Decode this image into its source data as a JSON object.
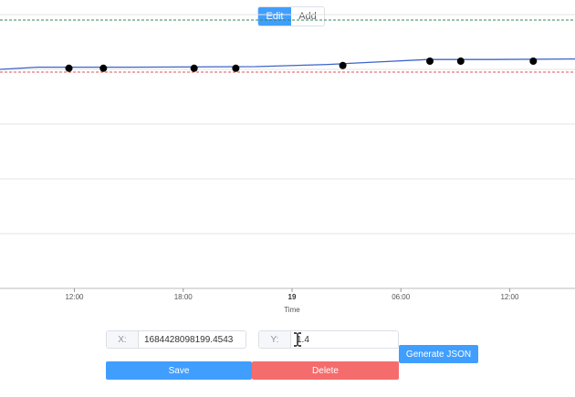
{
  "mode_toggle": {
    "edit_label": "Edit",
    "add_label": "Add",
    "active": "edit"
  },
  "chart_data": {
    "type": "line",
    "xlabel": "Time",
    "x_ticks": [
      {
        "label": "12:00",
        "x": 12
      },
      {
        "label": "18:00",
        "x": 18
      },
      {
        "label": "19",
        "x": 24,
        "bold": true
      },
      {
        "label": "06:00",
        "x": 30
      },
      {
        "label": "12:00",
        "x": 36
      }
    ],
    "xlim": [
      7.9,
      39.6
    ],
    "ylim": [
      0,
      5
    ],
    "grid": true,
    "upper_threshold": 4.9,
    "lower_threshold": 3.95,
    "line": [
      {
        "x": 7.9,
        "y": 4.0
      },
      {
        "x": 10,
        "y": 4.04
      },
      {
        "x": 15,
        "y": 4.04
      },
      {
        "x": 22,
        "y": 4.05
      },
      {
        "x": 26,
        "y": 4.09
      },
      {
        "x": 29,
        "y": 4.14
      },
      {
        "x": 31.5,
        "y": 4.18
      },
      {
        "x": 35,
        "y": 4.18
      },
      {
        "x": 39.6,
        "y": 4.19
      }
    ],
    "points": [
      {
        "x": 11.7,
        "y": 4.02
      },
      {
        "x": 13.6,
        "y": 4.02
      },
      {
        "x": 18.6,
        "y": 4.02
      },
      {
        "x": 20.9,
        "y": 4.02
      },
      {
        "x": 26.8,
        "y": 4.07
      },
      {
        "x": 31.6,
        "y": 4.15
      },
      {
        "x": 33.3,
        "y": 4.15
      },
      {
        "x": 37.3,
        "y": 4.15
      }
    ],
    "colors": {
      "line": "#3c64c8",
      "upper": "#2e8b57",
      "lower": "#e0505a",
      "point": "#000000",
      "grid": "#e6e6e6"
    }
  },
  "form": {
    "x_prefix": "X:",
    "x_value": "1684428098199.4543",
    "y_prefix": "Y:",
    "y_value": "1.4",
    "save_label": "Save",
    "delete_label": "Delete",
    "generate_label": "Generate JSON"
  },
  "colors": {
    "primary": "#409eff",
    "danger": "#f56c6c"
  }
}
